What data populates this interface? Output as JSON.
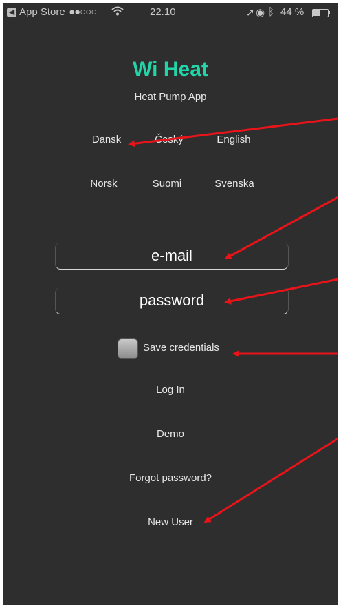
{
  "status_bar": {
    "carrier": "App Store",
    "signal": "●●○○○",
    "time": "22.10",
    "battery": "44 %",
    "battery_level": 0.44
  },
  "app": {
    "title": "Wi Heat",
    "subtitle": "Heat Pump App"
  },
  "languages": [
    "Dansk",
    "Český",
    "English",
    "Norsk",
    "Suomi",
    "Svenska"
  ],
  "login": {
    "email_placeholder": "e-mail",
    "password_placeholder": "password",
    "save_credentials": "Save credentials",
    "log_in": "Log In",
    "demo": "Demo",
    "forgot_password": "Forgot password?",
    "new_user": "New User"
  },
  "colors": {
    "accent": "#22d4a8",
    "background": "#2e2e2e",
    "annotation_arrow": "#e8141a"
  }
}
